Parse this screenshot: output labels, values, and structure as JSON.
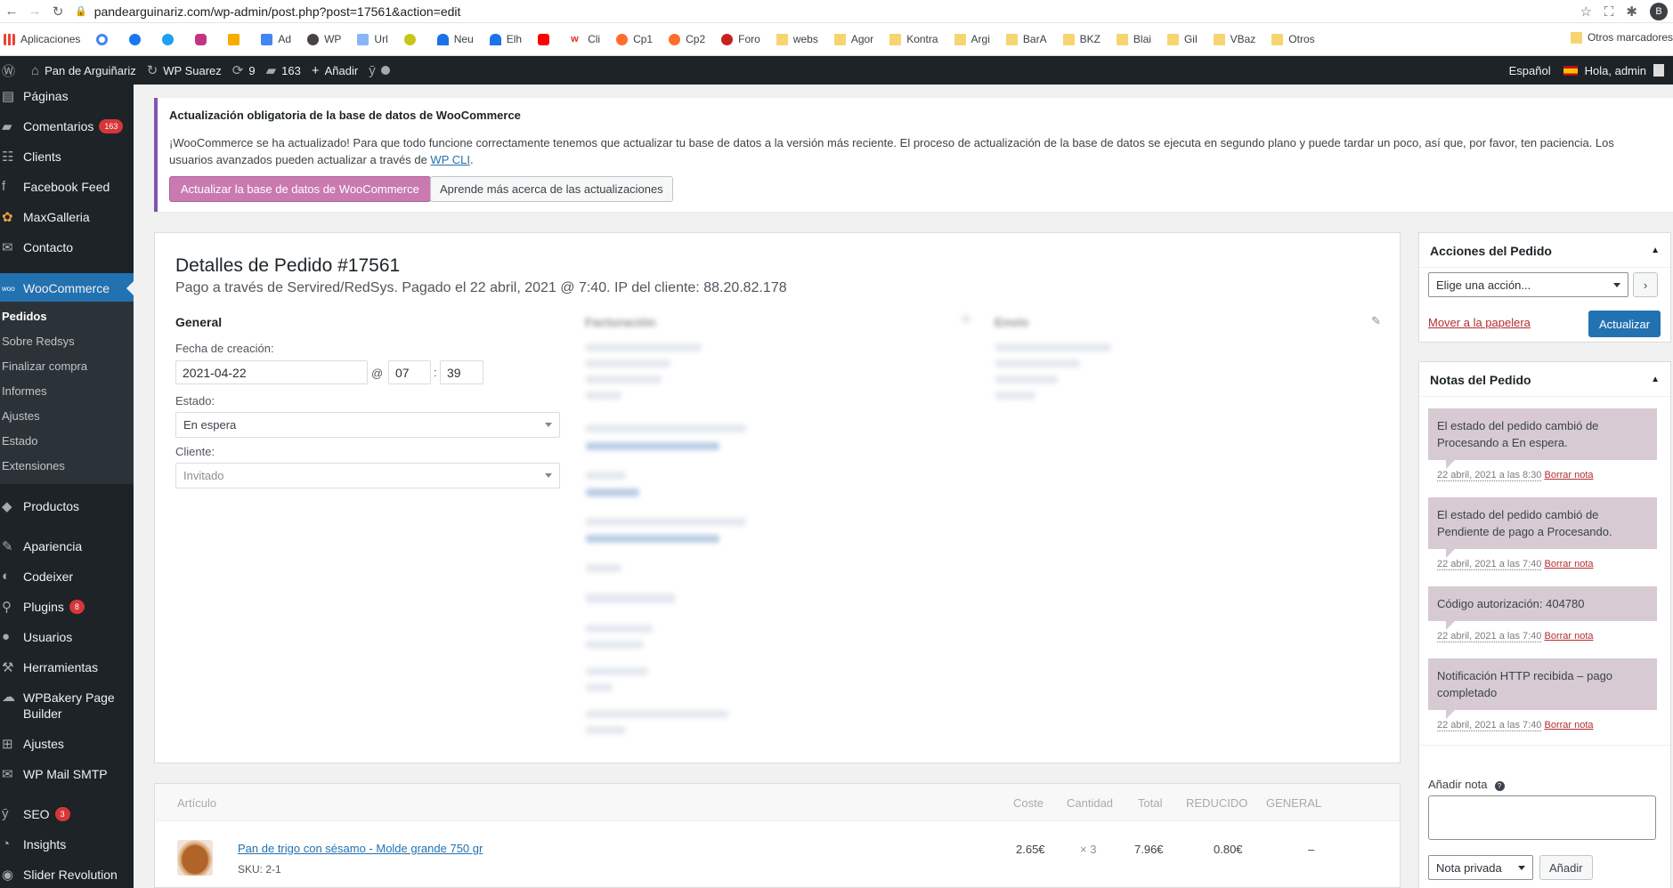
{
  "browser": {
    "url": "pandearguinariz.com/wp-admin/post.php?post=17561&action=edit",
    "profile_initial": "B",
    "bookmarks": [
      "Aplicaciones",
      "Ad",
      "WP",
      "Url",
      "Neu",
      "Elh",
      "Cli",
      "Cp1",
      "Cp2",
      "Foro",
      "webs",
      "Agor",
      "Kontra",
      "Argi",
      "BarA",
      "BKZ",
      "Blai",
      "Gil",
      "VBaz",
      "Otros"
    ],
    "other_bookmarks": "Otros marcadores"
  },
  "adminbar": {
    "site_name": "Pan de Arguiñariz",
    "theme_name": "WP Suarez",
    "updates_count": "9",
    "comments_count": "163",
    "add_new": "Añadir",
    "language": "Español",
    "greeting": "Hola, admin"
  },
  "sidebar": {
    "items": [
      {
        "label": "Páginas"
      },
      {
        "label": "Comentarios",
        "badge": "163"
      },
      {
        "label": "Clients"
      },
      {
        "label": "Facebook Feed"
      },
      {
        "label": "MaxGalleria"
      },
      {
        "label": "Contacto"
      },
      {
        "label": "WooCommerce"
      },
      {
        "label": "Productos"
      },
      {
        "label": "Apariencia"
      },
      {
        "label": "Codeixer"
      },
      {
        "label": "Plugins",
        "badge": "8"
      },
      {
        "label": "Usuarios"
      },
      {
        "label": "Herramientas"
      },
      {
        "label": "WPBakery Page Builder"
      },
      {
        "label": "Ajustes"
      },
      {
        "label": "WP Mail SMTP"
      },
      {
        "label": "SEO",
        "badge": "3"
      },
      {
        "label": "Insights"
      },
      {
        "label": "Slider Revolution"
      }
    ],
    "woocommerce_badge": "woo",
    "submenu": [
      "Pedidos",
      "Sobre Redsys",
      "Finalizar compra",
      "Informes",
      "Ajustes",
      "Estado",
      "Extensiones"
    ]
  },
  "notice": {
    "title": "Actualización obligatoria de la base de datos de WooCommerce",
    "body": "¡WooCommerce se ha actualizado! Para que todo funcione correctamente tenemos que actualizar tu base de datos a la versión más reciente. El proceso de actualización de la base de datos se ejecuta en segundo plano y puede tardar un poco, así que, por favor, ten paciencia. Los usuarios avanzados pueden actualizar a través de ",
    "link": "WP CLI",
    "body_end": ".",
    "primary_button": "Actualizar la base de datos de WooCommerce",
    "secondary_button": "Aprende más acerca de las actualizaciones"
  },
  "order": {
    "title": "Detalles de Pedido #17561",
    "subtitle": "Pago a través de Servired/RedSys. Pagado el 22 abril, 2021 @ 7:40. IP del cliente: 88.20.82.178",
    "general_heading": "General",
    "billing_heading": "Facturación",
    "shipping_heading": "Envío",
    "created_label": "Fecha de creación:",
    "date": "2021-04-22",
    "at": "@",
    "hour": "07",
    "colon": ":",
    "minute": "39",
    "status_label": "Estado:",
    "status_value": "En espera",
    "customer_label": "Cliente:",
    "customer_value": "Invitado"
  },
  "items": {
    "headers": {
      "item": "Artículo",
      "cost": "Coste",
      "qty": "Cantidad",
      "total": "Total",
      "reduced": "REDUCIDO",
      "general": "GENERAL"
    },
    "rows": [
      {
        "name": "Pan de trigo con sésamo - Molde grande 750 gr",
        "sku": "SKU: 2-1",
        "cost": "2.65€",
        "qty": "× 3",
        "total": "7.96€",
        "reduced": "0.80€",
        "general": "–"
      }
    ]
  },
  "actions": {
    "title": "Acciones del Pedido",
    "select": "Elige una acción...",
    "go": "›",
    "trash": "Mover a la papelera",
    "update": "Actualizar"
  },
  "notes": {
    "title": "Notas del Pedido",
    "delete_label": "Borrar nota",
    "items": [
      {
        "text": "El estado del pedido cambió de Procesando a En espera.",
        "date": "22 abril, 2021 a las 8:30"
      },
      {
        "text": "El estado del pedido cambió de Pendiente de pago a Procesando.",
        "date": "22 abril, 2021 a las 7:40"
      },
      {
        "text": "Código autorización: 404780",
        "date": "22 abril, 2021 a las 7:40"
      },
      {
        "text": "Notificación HTTP recibida – pago completado",
        "date": "22 abril, 2021 a las 7:40"
      }
    ],
    "add_label": "Añadir nota",
    "help": "?",
    "type": "Nota privada",
    "add_button": "Añadir"
  },
  "colors": {
    "wp_dark": "#1d2327",
    "wp_blue": "#2271b1",
    "woo_purple": "#7f54b3",
    "note_bg": "#d7cad2",
    "badge_red": "#d63638"
  }
}
